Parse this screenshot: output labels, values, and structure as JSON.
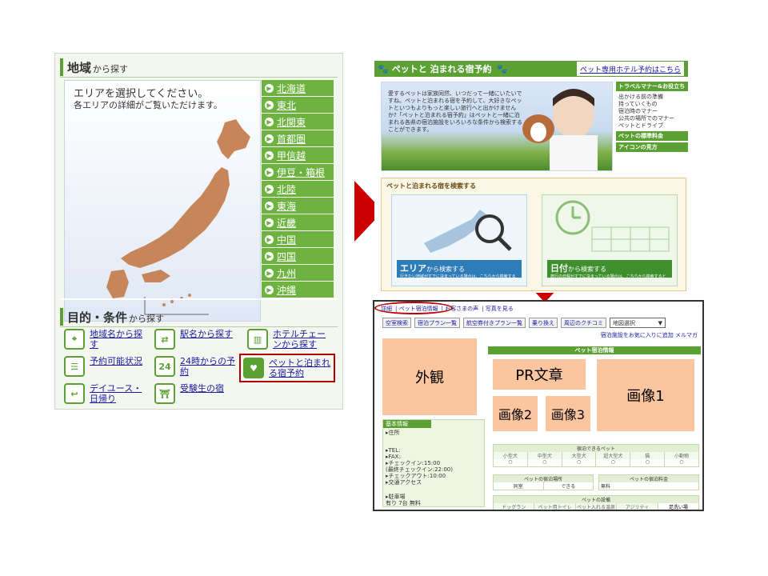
{
  "left": {
    "area_title": "地域",
    "area_sub": "から探す",
    "map_line1": "エリアを選択してください。",
    "map_line2": "各エリアの詳細がご覧いただけます。",
    "regions": [
      "北海道",
      "東北",
      "北関東",
      "首都圏",
      "甲信越",
      "伊豆・箱根",
      "北陸",
      "東海",
      "近畿",
      "中国",
      "四国",
      "九州",
      "沖縄"
    ],
    "cond_title": "目的・条件",
    "cond_sub": "から探す",
    "conditions": [
      {
        "label": "地域名から探す",
        "icon": "map-icon"
      },
      {
        "label": "駅名から探す",
        "icon": "train-icon"
      },
      {
        "label": "ホテルチェーンから探す",
        "icon": "building-icon"
      },
      {
        "label": "予約可能状況",
        "icon": "list-icon"
      },
      {
        "label": "24時からの予約",
        "icon": "clock24-icon"
      },
      {
        "label": "ペットと泊まれる宿予約",
        "icon": "cat-icon"
      },
      {
        "label": "デイユース・日帰り",
        "icon": "return-icon"
      },
      {
        "label": "受験生の宿",
        "icon": "shrine-icon"
      }
    ],
    "icon_24": "24"
  },
  "site": {
    "title": "ペットと 泊まれる宿予約",
    "link": "ペット専用ホテル予約はこちら",
    "hero_text": "愛するペットは家族同然、いつだって一緒にいたいですね。ペットと泊まれる宿を予約して、大好きなペットといつもよりもっと楽しい旅行へと出かけませんか?「ペットと泊まれる宿予約」はペットと一緒に泊まれる各県の宿泊施設をいろいろな条件から検索することができます。",
    "menu": [
      "トラベルマナー&お役立ち",
      "ペットの標準料金",
      "アイコンの見方"
    ],
    "menu_items": [
      "出かける前の準備",
      "持っていくもの",
      "宿泊時のマナー",
      "公共の場所でのマナー",
      "ペットとドライブ"
    ],
    "search_head": "ペットと泊まれる宿を検索する",
    "area_btn": "エリア",
    "area_btn_sub": "から検索する",
    "area_desc": "行きたい地域がすでに決まっている場合は、こちらから検索すると便利です",
    "date_btn": "日付",
    "date_btn_sub": "から検索する",
    "date_desc": "旅行の日程がすでに決まっている場合は、こちらから検索すると便利です"
  },
  "detail": {
    "tabs": [
      "詳細",
      "ペット宿泊情報",
      "お客さまの声",
      "写真を見る"
    ],
    "tools": [
      "空室検索",
      "宿泊プラン一覧",
      "航空券付きプラン一覧",
      "乗り換え",
      "周辺のクチコミ"
    ],
    "select_label": "地図選択",
    "fav": "宿泊施設をお気に入りに追加",
    "mail": "メルマガ",
    "exterior": "外観",
    "pr": "PR文章",
    "img1": "画像1",
    "img2": "画像2",
    "img3": "画像3",
    "pet_info": "ペット宿泊情報",
    "basic": "基本情報",
    "info_lines": [
      "▸住所",
      "▸TEL:",
      "▸FAX:",
      "▸チェックイン:15:00",
      "(最終チェックイン:22:00)",
      "▸チェックアウト:10:00",
      "▸交通アクセス",
      "▸駐車場",
      "有り 7台 無料"
    ],
    "pets_head": "宿泊できるペット",
    "pets": [
      "小型犬",
      "中型犬",
      "大型犬",
      "超大型犬",
      "猫",
      "小動物"
    ],
    "mark": "○",
    "place_head": "ペットの宿泊場所",
    "fee_head": "ペットの宿泊料金",
    "place_cells": [
      "同室",
      "できる"
    ],
    "fee_cell": "無料",
    "equip_head": "ペットの設備",
    "equip_cells": [
      "ドッグラン",
      "ペット用トイレ",
      "ペット入れる温泉",
      "アジリティ",
      "足洗い場"
    ]
  }
}
